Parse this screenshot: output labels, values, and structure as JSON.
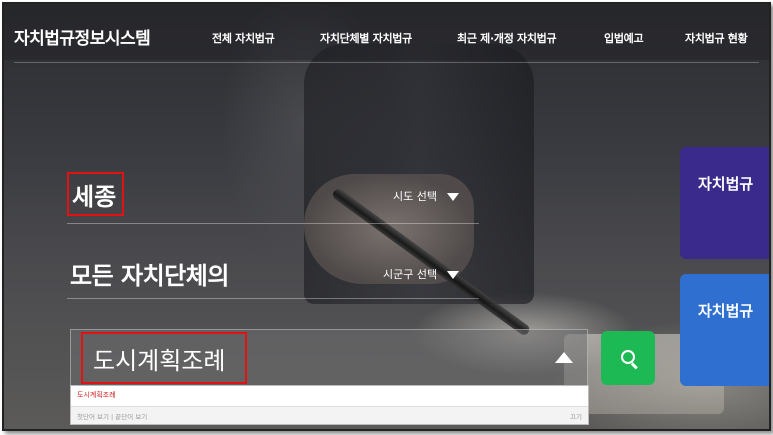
{
  "header": {
    "brand": "자치법규정보시스템",
    "nav": [
      {
        "label": "전체 자치법규"
      },
      {
        "label": "자치단체별 자치법규"
      },
      {
        "label": "최근 제·개정 자치법규"
      },
      {
        "label": "입법예고"
      },
      {
        "label": "자치법규 현황"
      }
    ]
  },
  "hero": {
    "region_title": "세종",
    "subtitle": "모든 자치단체의",
    "sido_select": "시도 선택",
    "sigungu_select": "시군구 선택"
  },
  "search": {
    "value": "도시계획조례",
    "suggestions": [
      "도시계획조례"
    ],
    "footer_left": "첫단어 보기 | 끝단어 보기",
    "footer_right": "끄기"
  },
  "side_cards": [
    {
      "label": "자치법규",
      "color": "#3a2a8c"
    },
    {
      "label": "자치법규",
      "color": "#2f6fd0"
    }
  ],
  "colors": {
    "accent_green": "#1db954",
    "highlight_red": "#e21212"
  }
}
